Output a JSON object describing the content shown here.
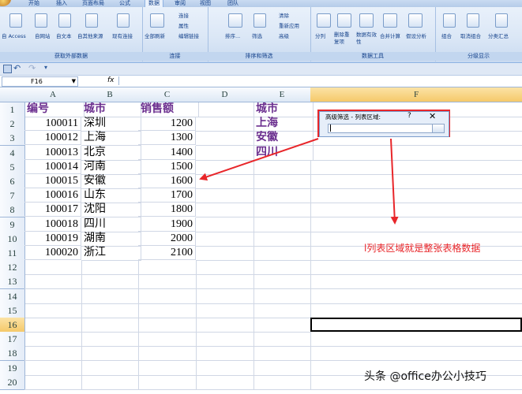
{
  "ribbon": {
    "tabs": [
      "开始",
      "插入",
      "页面布局",
      "公式",
      "数据",
      "审阅",
      "视图",
      "团队"
    ],
    "active_tab": "数据",
    "groups": [
      {
        "label": "获取外部数据",
        "buttons": [
          "自 Access",
          "自网站",
          "自文本",
          "自其他来源",
          "现有连接"
        ]
      },
      {
        "label": "连接",
        "buttons": [
          "全部刷新",
          "连接",
          "属性",
          "编辑链接"
        ]
      },
      {
        "label": "排序和筛选",
        "buttons": [
          "排序...",
          "筛选",
          "清除",
          "重新应用",
          "高级"
        ]
      },
      {
        "label": "数据工具",
        "buttons": [
          "分列",
          "删除重复项",
          "数据有效性",
          "合并计算",
          "假设分析"
        ]
      },
      {
        "label": "分级显示",
        "buttons": [
          "组合",
          "取消组合",
          "分类汇总"
        ]
      }
    ]
  },
  "formula_bar": {
    "name_box": "F16",
    "fx": "fx"
  },
  "columns": [
    "A",
    "B",
    "C",
    "D",
    "E",
    "F"
  ],
  "rows": [
    "1",
    "2",
    "3",
    "4",
    "5",
    "6",
    "7",
    "8",
    "9",
    "10",
    "11",
    "12",
    "13",
    "14",
    "15",
    "16",
    "17",
    "18",
    "19",
    "20"
  ],
  "selected": {
    "column": "F",
    "row": "16"
  },
  "table": {
    "headers": [
      "编号",
      "城市",
      "销售额"
    ],
    "records": [
      [
        "100011",
        "深圳",
        "1200"
      ],
      [
        "100012",
        "上海",
        "1300"
      ],
      [
        "100013",
        "北京",
        "1400"
      ],
      [
        "100014",
        "河南",
        "1500"
      ],
      [
        "100015",
        "安徽",
        "1600"
      ],
      [
        "100016",
        "山东",
        "1700"
      ],
      [
        "100017",
        "沈阳",
        "1800"
      ],
      [
        "100018",
        "四川",
        "1900"
      ],
      [
        "100019",
        "湖南",
        "2000"
      ],
      [
        "100020",
        "浙江",
        "2100"
      ]
    ]
  },
  "criteria": {
    "header": "城市",
    "values": [
      "上海",
      "安徽",
      "四川"
    ]
  },
  "dialog": {
    "title": "高级筛选 - 列表区域:",
    "help": "?",
    "close": "✕",
    "input_value": ""
  },
  "annotation": "l列表区域就是整张表格数据",
  "watermark": "头条 @office办公小技巧",
  "colors": {
    "accent_red": "#e8262a",
    "header_purple": "#6b2f8f",
    "selected_header": "#f5c96a"
  }
}
